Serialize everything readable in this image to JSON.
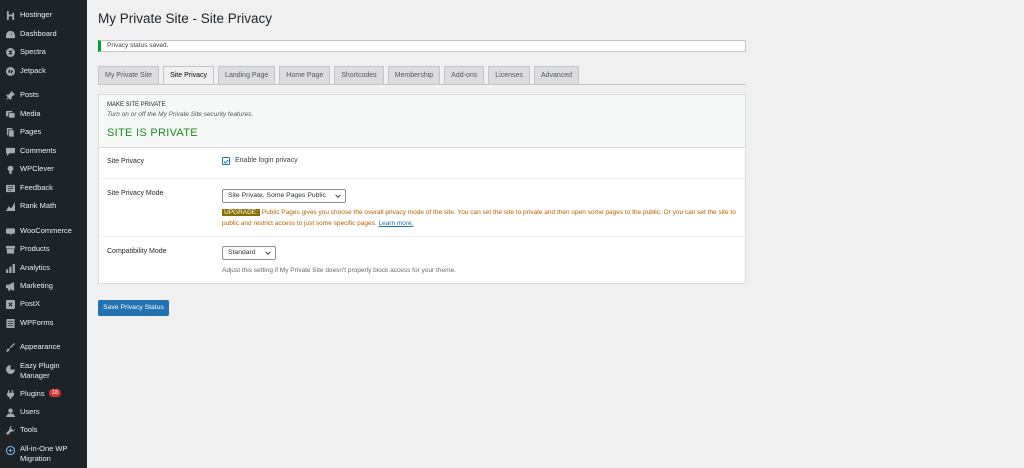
{
  "sidebar": {
    "items": [
      {
        "label": "Hostinger",
        "icon": "hostinger-icon"
      },
      {
        "label": "Dashboard",
        "icon": "dashboard-icon"
      },
      {
        "label": "Spectra",
        "icon": "spectra-icon"
      },
      {
        "label": "Jetpack",
        "icon": "jetpack-icon"
      },
      {
        "label": "Posts",
        "icon": "pin-icon"
      },
      {
        "label": "Media",
        "icon": "media-icon"
      },
      {
        "label": "Pages",
        "icon": "pages-icon"
      },
      {
        "label": "Comments",
        "icon": "comment-icon"
      },
      {
        "label": "WPClever",
        "icon": "bulb-icon"
      },
      {
        "label": "Feedback",
        "icon": "feedback-icon"
      },
      {
        "label": "Rank Math",
        "icon": "chart-icon"
      },
      {
        "label": "WooCommerce",
        "icon": "woocommerce-icon"
      },
      {
        "label": "Products",
        "icon": "archive-icon"
      },
      {
        "label": "Analytics",
        "icon": "bar-chart-icon"
      },
      {
        "label": "Marketing",
        "icon": "megaphone-icon"
      },
      {
        "label": "PostX",
        "icon": "postx-icon"
      },
      {
        "label": "WPForms",
        "icon": "forms-icon"
      },
      {
        "label": "Appearance",
        "icon": "paintbrush-icon"
      },
      {
        "label": "Eazy Plugin Manager",
        "icon": "plugin-manager-icon"
      },
      {
        "label": "Plugins",
        "icon": "plugin-icon",
        "badge": "18"
      },
      {
        "label": "Users",
        "icon": "users-icon"
      },
      {
        "label": "Tools",
        "icon": "wrench-icon"
      },
      {
        "label": "All-in-One WP Migration",
        "icon": "migration-icon"
      }
    ]
  },
  "page": {
    "title": "My Private Site - Site Privacy",
    "notice": "Privacy status saved."
  },
  "tabs": [
    {
      "label": "My Private Site",
      "active": false
    },
    {
      "label": "Site Privacy",
      "active": true
    },
    {
      "label": "Landing Page",
      "active": false
    },
    {
      "label": "Home Page",
      "active": false
    },
    {
      "label": "Shortcodes",
      "active": false
    },
    {
      "label": "Membership",
      "active": false
    },
    {
      "label": "Add-ons",
      "active": false
    },
    {
      "label": "Licenses",
      "active": false
    },
    {
      "label": "Advanced",
      "active": false
    }
  ],
  "panel": {
    "section_title": "MAKE SITE PRIVATE",
    "section_desc": "Turn on or off the My Private Site security features.",
    "status": "SITE IS PRIVATE",
    "status_color": "#1e8a1e",
    "privacy": {
      "label": "Site Privacy",
      "checkbox_label": "Enable login privacy",
      "checked": true
    },
    "mode": {
      "label": "Site Privacy Mode",
      "selected": "Site Private, Some Pages Public",
      "upgrade_badge": "UPGRADE:",
      "upgrade_text": " Public Pages gives you choose the overall privacy mode of the site. You can set the site to private and then open some pages to the public. Or you can set the site to public and restrict access to just some specific pages. ",
      "learn_more": "Learn more."
    },
    "compat": {
      "label": "Compatibility Mode",
      "selected": "Standard",
      "desc": "Adjust this setting if My Private Site doesn't properly block access for your theme."
    }
  },
  "save_button": "Save Privacy Status",
  "colors": {
    "sidebar_bg": "#1d2327",
    "accent": "#2271b1",
    "badge": "#d63638",
    "upgrade": "#b26200"
  }
}
